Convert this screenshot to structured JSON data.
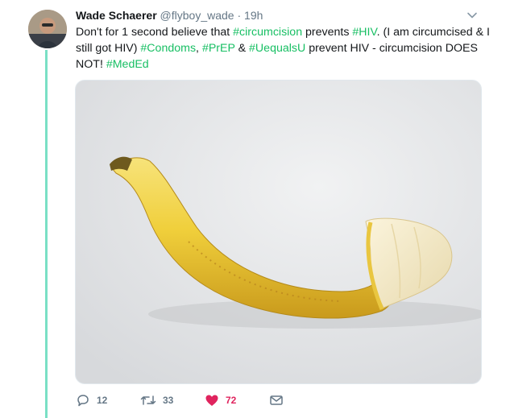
{
  "tweet": {
    "author_name": "Wade Schaerer",
    "handle": "@flyboy_wade",
    "separator": "·",
    "time": "19h",
    "text": [
      {
        "t": "Don't for 1 second believe that ",
        "tag": false
      },
      {
        "t": "#circumcision",
        "tag": true
      },
      {
        "t": " prevents ",
        "tag": false
      },
      {
        "t": "#HIV",
        "tag": true
      },
      {
        "t": ". (I am circumcised & I still got HIV) ",
        "tag": false
      },
      {
        "t": "#Condoms",
        "tag": true
      },
      {
        "t": ", ",
        "tag": false
      },
      {
        "t": "#PrEP",
        "tag": true
      },
      {
        "t": " & ",
        "tag": false
      },
      {
        "t": "#UequalsU",
        "tag": true
      },
      {
        "t": " prevent HIV - circumcision DOES NOT! ",
        "tag": false
      },
      {
        "t": "#MedEd",
        "tag": true
      }
    ]
  },
  "actions": {
    "reply_count": "12",
    "retweet_count": "33",
    "like_count": "72"
  },
  "colors": {
    "hashtag": "#17bf63",
    "thread_line": "#79e0c5",
    "like": "#e0245e",
    "muted": "#657786"
  },
  "icons": [
    "avatar",
    "chevron-down-icon",
    "reply-icon",
    "retweet-icon",
    "heart-icon",
    "envelope-icon"
  ]
}
